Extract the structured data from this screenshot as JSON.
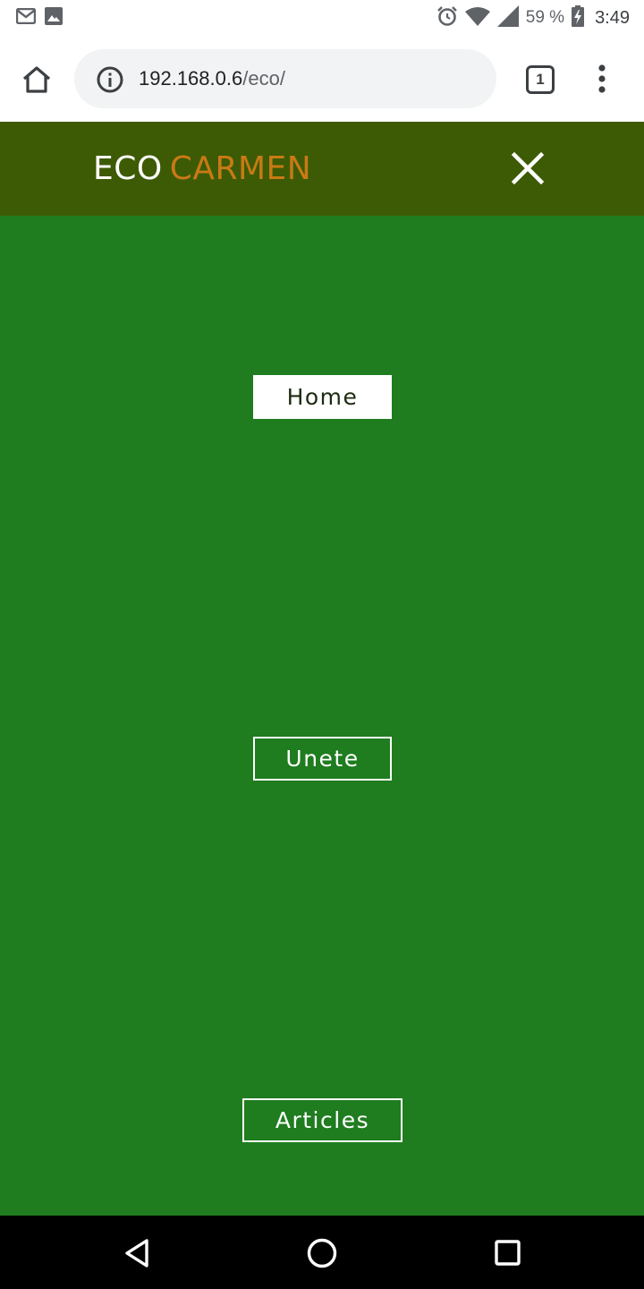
{
  "status_bar": {
    "left_icons": [
      "gmail-icon",
      "gallery-icon"
    ],
    "right_icons": [
      "alarm-icon",
      "wifi-icon",
      "signal-icon",
      "battery-charging-icon"
    ],
    "battery_percent": "59 %",
    "time": "3:49"
  },
  "browser": {
    "url_host": "192.168.0.6",
    "url_path": "/eco/",
    "tab_count": "1",
    "icons": {
      "home": "home-icon",
      "info": "info-icon",
      "tabs": "tab-switcher-icon",
      "menu": "more-vert-icon"
    }
  },
  "site": {
    "logo_part1": "ECO",
    "logo_part2": "CARMEN",
    "close_icon": "close-icon",
    "colors": {
      "header_bg": "#3d5b05",
      "menu_bg": "#1f7c1f",
      "logo_accent": "#c97a14",
      "button_border": "#ffffff"
    }
  },
  "menu": {
    "items": [
      {
        "label": "Home",
        "active": true
      },
      {
        "label": "Unete",
        "active": false
      },
      {
        "label": "Articles",
        "active": false
      }
    ]
  },
  "android_nav": {
    "icons": [
      "back-icon",
      "home-circle-icon",
      "recents-icon"
    ]
  }
}
